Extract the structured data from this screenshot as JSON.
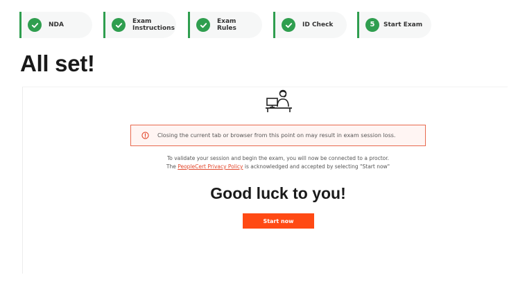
{
  "stepper": {
    "steps": [
      {
        "label_1": "NDA",
        "label_2": "",
        "status": "complete",
        "icon": "check-icon"
      },
      {
        "label_1": "Exam",
        "label_2": "Instructions",
        "status": "complete",
        "icon": "check-icon"
      },
      {
        "label_1": "Exam",
        "label_2": "Rules",
        "status": "complete",
        "icon": "check-icon"
      },
      {
        "label_1": "ID Check",
        "label_2": "",
        "status": "complete",
        "icon": "check-icon"
      },
      {
        "label_1": "Start Exam",
        "label_2": "",
        "status": "current",
        "number": "5"
      }
    ],
    "accent_color": "#2f9e4f"
  },
  "page": {
    "title": "All set!"
  },
  "main": {
    "illustration": "proctor-at-desk-icon",
    "warning": {
      "icon": "exclamation-circle-icon",
      "text": "Closing the current tab or browser from this point on may result in exam session loss.",
      "border_color": "#e8694d"
    },
    "info_line_1": "To validate your session and begin the exam, you will now be connected to a proctor.",
    "info_line_2_prefix": "The ",
    "privacy_link": "PeopleCert Privacy Policy",
    "info_line_2_suffix": " is acknowledged and accepted by selecting \"Start now\"",
    "heading": "Good luck to you!",
    "start_button": {
      "label": "Start now",
      "color": "#ff4a14"
    }
  }
}
